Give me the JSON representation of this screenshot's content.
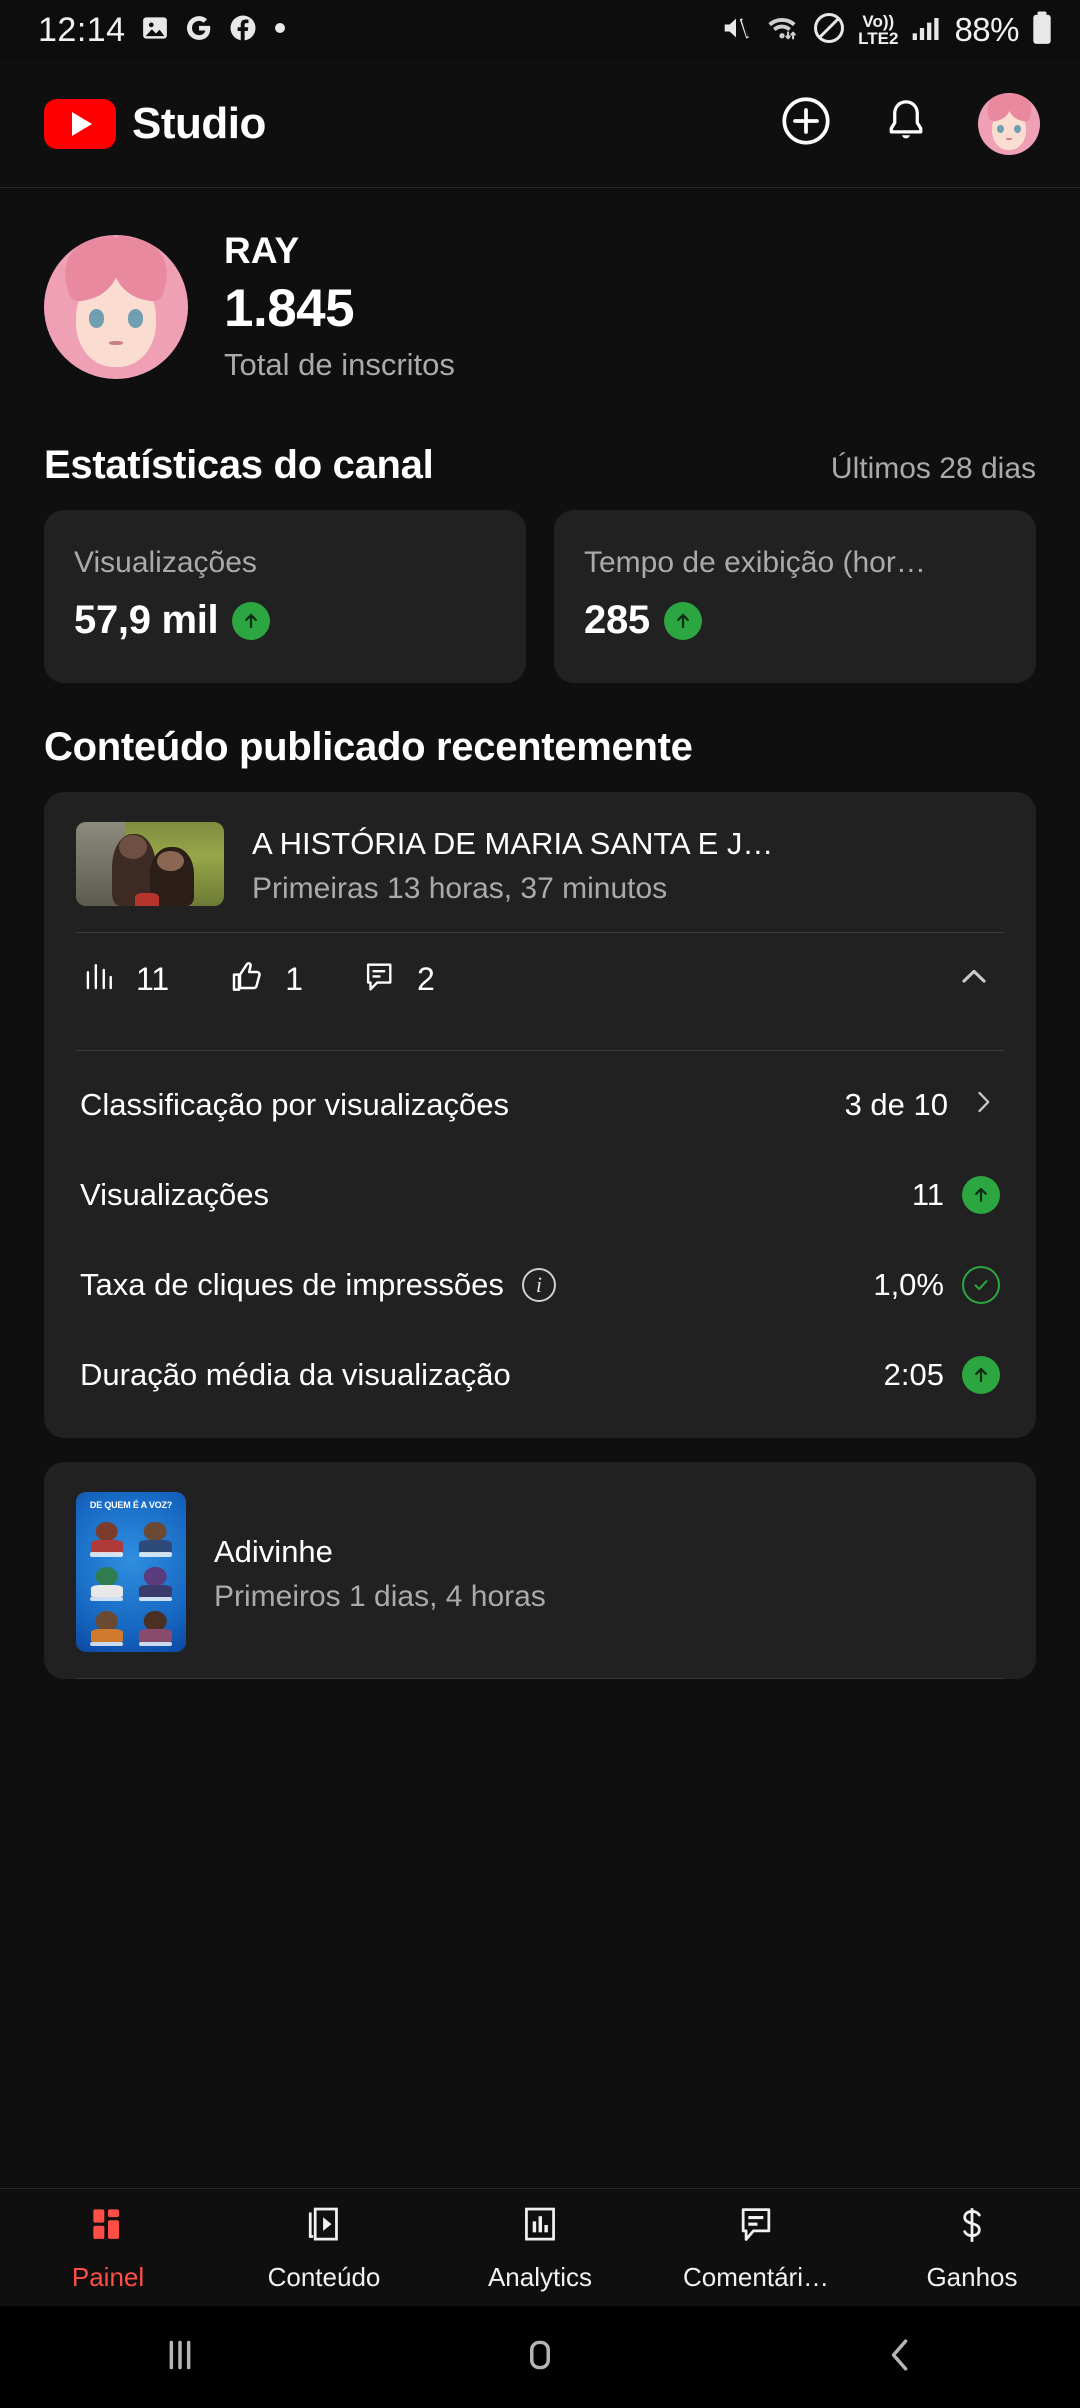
{
  "status_bar": {
    "time": "12:14",
    "left_icons": [
      "image-icon",
      "google-icon",
      "facebook-icon",
      "dot-icon"
    ],
    "right_icons": [
      "mute-icon",
      "wifi-icon",
      "do-not-disturb-icon",
      "signal-icon"
    ],
    "volte_top": "Vo))",
    "volte_bottom": "LTE2",
    "battery_percent": "88%"
  },
  "app_bar": {
    "brand": "Studio",
    "logo": "youtube-logo",
    "create_label": "create-icon",
    "notifications_label": "bell-icon",
    "avatar_label": "account-avatar"
  },
  "channel": {
    "name": "RAY",
    "subscriber_count": "1.845",
    "subscriber_label": "Total de inscritos"
  },
  "channel_stats": {
    "title": "Estatísticas do canal",
    "period": "Últimos 28 dias",
    "cards": [
      {
        "label": "Visualizações",
        "value": "57,9 mil",
        "trend": "up"
      },
      {
        "label": "Tempo de exibição (hor…",
        "value": "285",
        "trend": "up"
      }
    ]
  },
  "recent_content": {
    "title": "Conteúdo publicado recentemente",
    "videos": [
      {
        "title": "A HISTÓRIA DE MARIA SANTA E J…",
        "subtitle": "Primeiras 13 horas, 37 minutos",
        "thumbnail": "couple-outdoor-thumbnail",
        "expanded": true,
        "engagement": [
          {
            "icon": "views-bars-icon",
            "value": "11"
          },
          {
            "icon": "thumbs-up-icon",
            "value": "1"
          },
          {
            "icon": "comment-icon",
            "value": "2"
          }
        ],
        "collapse_icon": "chevron-up-icon",
        "metrics": [
          {
            "label": "Classificação por visualizações",
            "value": "3 de 10",
            "indicator": "chevron-right",
            "info": false
          },
          {
            "label": "Visualizações",
            "value": "11",
            "indicator": "up",
            "info": false
          },
          {
            "label": "Taxa de cliques de impressões",
            "value": "1,0%",
            "indicator": "check",
            "info": true
          },
          {
            "label": "Duração média da visualização",
            "value": "2:05",
            "indicator": "up",
            "info": false
          }
        ]
      },
      {
        "title": "Adivinhe",
        "subtitle": "Primeiros 1 dias, 4 horas",
        "thumbnail": "quiz-voice-thumbnail",
        "thumbnail_text": "DE QUEM É A VOZ?",
        "expanded": false
      }
    ]
  },
  "bottom_nav": {
    "items": [
      {
        "label": "Painel",
        "icon": "dashboard-icon",
        "active": true
      },
      {
        "label": "Conteúdo",
        "icon": "content-play-icon",
        "active": false
      },
      {
        "label": "Analytics",
        "icon": "analytics-bars-icon",
        "active": false
      },
      {
        "label": "Comentári…",
        "icon": "comments-icon",
        "active": false
      },
      {
        "label": "Ganhos",
        "icon": "earnings-dollar-icon",
        "active": false
      }
    ]
  },
  "android_nav": {
    "recents": "recents-icon",
    "home": "home-icon",
    "back": "back-icon"
  },
  "colors": {
    "accent": "#ff0000",
    "active_nav": "#ff4e45",
    "positive": "#2ba640",
    "card_bg": "#212121",
    "page_bg": "#0f0f0f"
  }
}
